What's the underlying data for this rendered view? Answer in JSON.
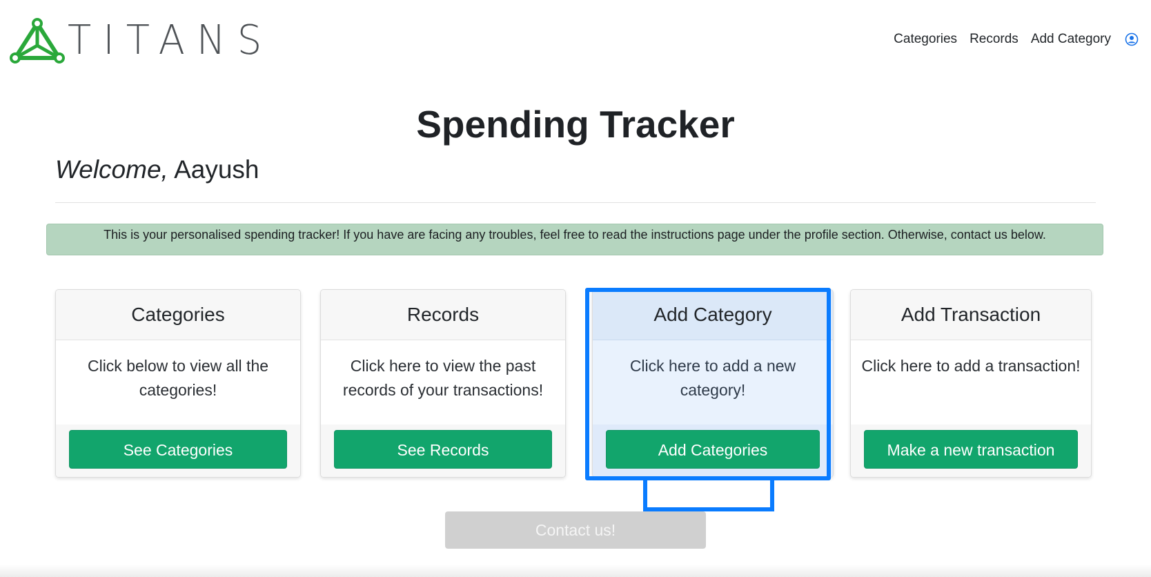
{
  "brand": {
    "name": "TITANS",
    "logo_color": "#2aa83a",
    "text_color": "#4f5357"
  },
  "nav": {
    "items": [
      {
        "label": "Categories"
      },
      {
        "label": "Records"
      },
      {
        "label": "Add Category"
      }
    ],
    "profile_icon": "user-circle-icon"
  },
  "page": {
    "title": "Spending Tracker",
    "welcome_greeting": "Welcome,",
    "welcome_name": "Aayush"
  },
  "banner": {
    "text": "This is your personalised spending tracker! If you have are facing any troubles, feel free to read the instructions page under the profile section. Otherwise, contact us below.",
    "color": "#b5d5bf"
  },
  "cards": [
    {
      "title": "Categories",
      "body": "Click below to view all the categories!",
      "button": "See Categories"
    },
    {
      "title": "Records",
      "body": "Click here to view the past records of your transactions!",
      "button": "See Records"
    },
    {
      "title": "Add Category",
      "body": "Click here to add a new category!",
      "button": "Add Categories",
      "highlighted": true
    },
    {
      "title": "Add Transaction",
      "body": "Click here to add a transaction!",
      "button": "Make a new transaction"
    }
  ],
  "contact": {
    "label": "Contact us!"
  },
  "colors": {
    "button_green": "#12a56c",
    "highlight_blue": "#0a7cff",
    "contact_gray": "#d0d0d0"
  }
}
